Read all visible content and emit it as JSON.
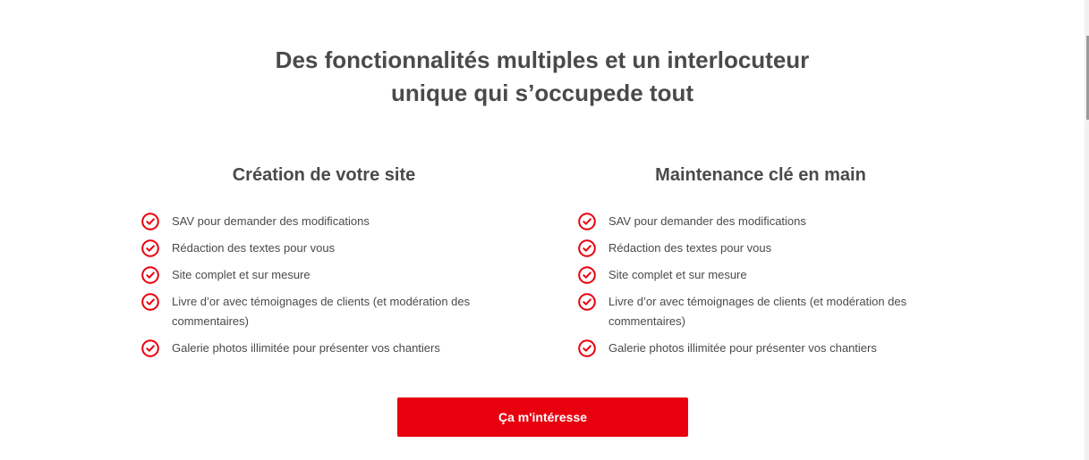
{
  "headline": {
    "line1": "Des fonctionnalités multiples et un interlocuteur",
    "line2": "unique qui s’occupede tout"
  },
  "columns": [
    {
      "title": "Création de votre site",
      "items": [
        "SAV pour demander des modifications",
        "Rédaction des textes pour vous",
        "Site complet et sur mesure",
        "Livre d’or avec témoignages de clients (et modération des commentaires)",
        "Galerie photos illimitée pour présenter vos chantiers"
      ]
    },
    {
      "title": "Maintenance clé en main",
      "items": [
        "SAV pour demander des modifications",
        "Rédaction des textes pour vous",
        "Site complet et sur mesure",
        "Livre d’or avec témoignages de clients (et modération des commentaires)",
        "Galerie photos illimitée pour présenter vos chantiers"
      ]
    }
  ],
  "cta": {
    "label": "Ça m'intéresse"
  },
  "icons": {
    "feature": "check-circle-icon"
  },
  "colors": {
    "accent": "#e8000e",
    "text": "#4a4a4a",
    "background": "#ffffff"
  }
}
